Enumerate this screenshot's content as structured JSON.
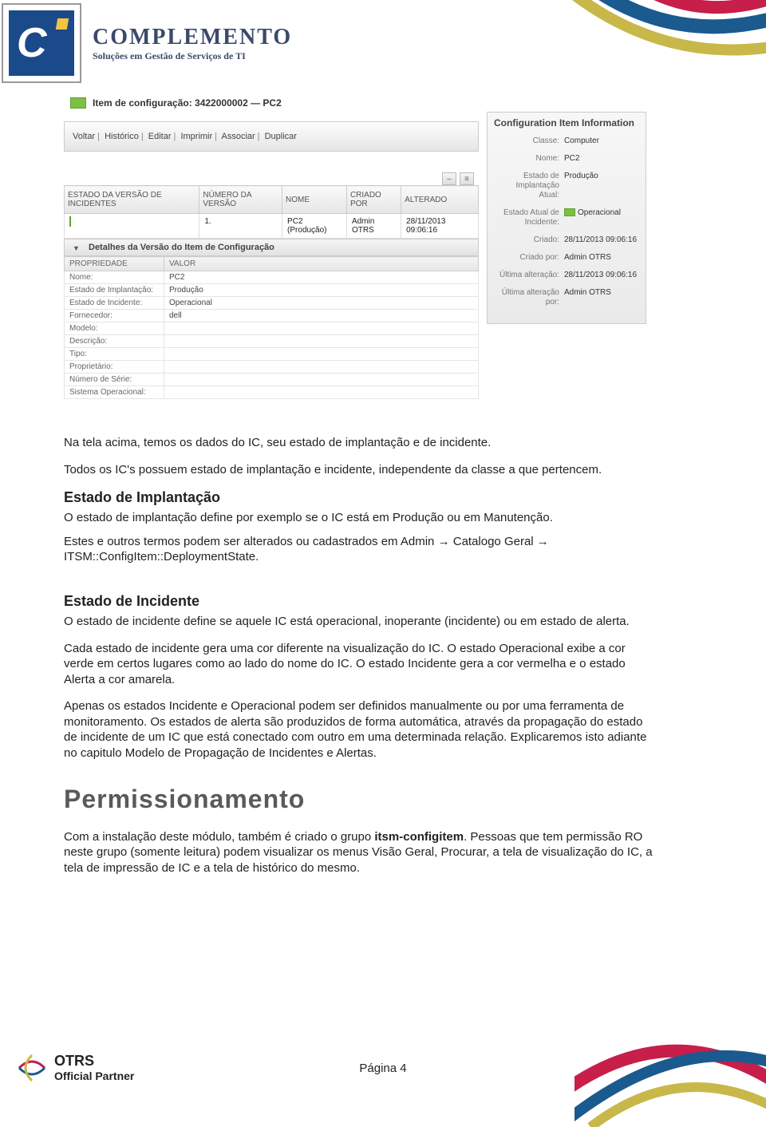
{
  "brand": {
    "line1": "COMPLEMENTO",
    "line2": "Soluções em Gestão de Serviços de TI"
  },
  "ci_header": {
    "label": "Item de configuração: 3422000002  —  PC2"
  },
  "actions": [
    "Voltar",
    "Histórico",
    "Editar",
    "Imprimir",
    "Associar",
    "Duplicar"
  ],
  "versions_table": {
    "cols": [
      "ESTADO DA VERSÃO DE INCIDENTES",
      "NÚMERO DA VERSÃO",
      "NOME",
      "CRIADO POR",
      "ALTERADO"
    ],
    "row": {
      "num": "1.",
      "nome": "PC2 (Produção)",
      "criado": "Admin OTRS",
      "alt": "28/11/2013 09:06:16"
    }
  },
  "details": {
    "title": "Detalhes da Versão do Item de Configuração",
    "cols": [
      "PROPRIEDADE",
      "VALOR"
    ],
    "rows": [
      {
        "k": "Nome:",
        "v": "PC2"
      },
      {
        "k": "Estado de Implantação:",
        "v": "Produção"
      },
      {
        "k": "Estado de Incidente:",
        "v": "Operacional"
      },
      {
        "k": "Fornecedor:",
        "v": "dell"
      },
      {
        "k": "Modelo:",
        "v": ""
      },
      {
        "k": "Descrição:",
        "v": ""
      },
      {
        "k": "Tipo:",
        "v": ""
      },
      {
        "k": "Proprietário:",
        "v": ""
      },
      {
        "k": "Número de Série:",
        "v": ""
      },
      {
        "k": "Sistema Operacional:",
        "v": ""
      }
    ]
  },
  "sidebar": {
    "title": "Configuration Item Information",
    "rows": [
      {
        "k": "Classe:",
        "v": "Computer"
      },
      {
        "k": "Nome:",
        "v": "PC2"
      },
      {
        "k": "Estado de Implantação Atual:",
        "v": "Produção"
      },
      {
        "k": "Estado Atual de Incidente:",
        "v": "Operacional",
        "dot": true
      },
      {
        "k": "Criado:",
        "v": "28/11/2013 09:06:16"
      },
      {
        "k": "Criado por:",
        "v": "Admin OTRS"
      },
      {
        "k": "Última alteração:",
        "v": "28/11/2013 09:06:16"
      },
      {
        "k": "Última alteração por:",
        "v": "Admin OTRS"
      }
    ]
  },
  "body": {
    "p1": "Na tela acima, temos os dados do IC, seu estado de implantação e de incidente.",
    "p2": "Todos os IC's possuem estado de implantação e incidente, independente da classe a que pertencem.",
    "h3a": "Estado de Implantação",
    "p3": "O estado de implantação define por exemplo se o IC está em Produção ou em Manutenção.",
    "p4": "Estes e outros termos podem ser alterados ou cadastrados em Admin → Catalogo Geral → ITSM::ConfigItem::DeploymentState.",
    "h3b": "Estado de Incidente",
    "p5": "O estado de incidente define se aquele IC está operacional, inoperante (incidente) ou em estado de alerta.",
    "p6": "Cada estado de incidente gera uma cor diferente na visualização do IC. O estado Operacional exibe a cor verde em certos lugares como ao lado do nome do IC. O estado Incidente gera a cor vermelha e o estado Alerta a cor amarela.",
    "p7": "Apenas os estados Incidente e Operacional podem ser definidos manualmente ou por uma ferramenta de monitoramento. Os estados de alerta são produzidos de forma automática, através da propagação do estado de incidente de um IC que está conectado com outro em uma determinada relação. Explicaremos isto adiante no capitulo Modelo de Propagação de Incidentes e Alertas.",
    "h2": "Permissionamento",
    "p8a": "Com a instalação deste módulo, também é criado o grupo ",
    "p8bold": "itsm-configitem",
    "p8b": ". Pessoas que tem permissão RO neste grupo (somente leitura) podem visualizar os menus Visão Geral, Procurar, a tela de visualização do IC, a tela de impressão de IC e a tela de histórico do mesmo."
  },
  "footer": {
    "otrs1": "OTRS",
    "otrs2": "Official Partner",
    "pagenum": "Página 4"
  }
}
